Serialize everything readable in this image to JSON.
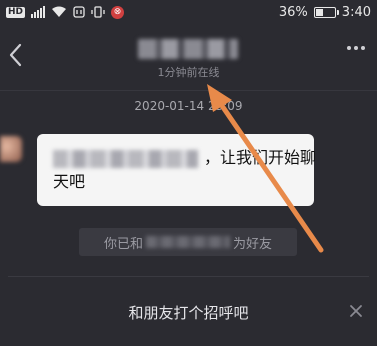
{
  "status_bar": {
    "hd_label": "HD",
    "app_badge": "⊗",
    "battery_percent": "36%",
    "time": "3:40"
  },
  "header": {
    "contact_status": "1分钟前在线"
  },
  "chat": {
    "timestamp": "2020-01-14 23:09",
    "message_line1_suffix": "，让我们开始聊",
    "message_line2": "天吧",
    "system_notice_prefix": "你已和",
    "system_notice_suffix": "为好友"
  },
  "greet_bar": {
    "label": "和朋友打个招呼吧"
  },
  "colors": {
    "background": "#2b2b31",
    "bubble": "#f5f5f5",
    "annotation_arrow": "#e88a4a"
  }
}
